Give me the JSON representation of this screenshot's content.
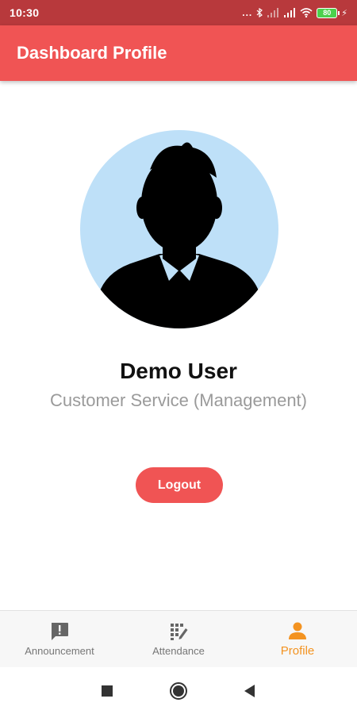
{
  "status_bar": {
    "time": "10:30",
    "dots": "...",
    "battery": "80",
    "colors": {
      "background": "#b8393c",
      "battery": "#4cd04c"
    }
  },
  "app_bar": {
    "title": "Dashboard Profile",
    "color": "#f05454"
  },
  "profile": {
    "avatar_icon": "user-silhouette-icon",
    "name": "Demo User",
    "role": "Customer Service (Management)",
    "logout_label": "Logout"
  },
  "bottom_nav": {
    "items": [
      {
        "label": "Announcement",
        "icon": "announcement-icon",
        "active": false
      },
      {
        "label": "Attendance",
        "icon": "attendance-icon",
        "active": false
      },
      {
        "label": "Profile",
        "icon": "person-icon",
        "active": true
      }
    ],
    "active_color": "#f39321"
  },
  "system_nav": {
    "buttons": [
      "recents-square-icon",
      "home-circle-icon",
      "back-triangle-icon"
    ]
  }
}
